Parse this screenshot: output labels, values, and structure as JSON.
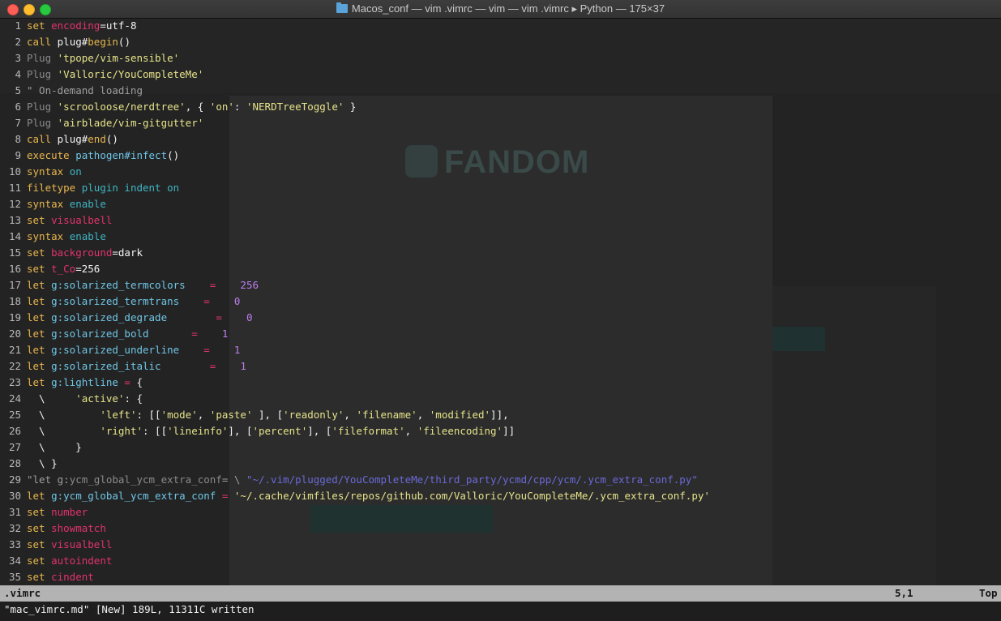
{
  "window": {
    "title": "Macos_conf — vim .vimrc — vim — vim .vimrc ▸ Python — 175×37"
  },
  "background": {
    "logo_text": "FANDOM"
  },
  "editor": {
    "lines": [
      {
        "n": "1",
        "segs": [
          [
            "k",
            "set "
          ],
          [
            "opt",
            "encoding"
          ],
          [
            "w",
            "=utf-8"
          ]
        ]
      },
      {
        "n": "2",
        "segs": [
          [
            "k",
            "call "
          ],
          [
            "w",
            "plug#"
          ],
          [
            "k",
            "begin"
          ],
          [
            "w",
            "()"
          ]
        ]
      },
      {
        "n": "3",
        "segs": [
          [
            "g",
            "Plug "
          ],
          [
            "s",
            "'tpope/vim-sensible'"
          ]
        ]
      },
      {
        "n": "4",
        "segs": [
          [
            "g",
            "Plug "
          ],
          [
            "s",
            "'Valloric/YouCompleteMe'"
          ]
        ]
      },
      {
        "n": "5",
        "segs": [
          [
            "c",
            "\" On-demand loading"
          ]
        ]
      },
      {
        "n": "6",
        "segs": [
          [
            "g",
            "Plug "
          ],
          [
            "s",
            "'scrooloose/nerdtree'"
          ],
          [
            "w",
            ", { "
          ],
          [
            "s",
            "'on'"
          ],
          [
            "w",
            ": "
          ],
          [
            "s",
            "'NERDTreeToggle'"
          ],
          [
            "w",
            " }"
          ]
        ]
      },
      {
        "n": "7",
        "segs": [
          [
            "g",
            "Plug "
          ],
          [
            "s",
            "'airblade/vim-gitgutter'"
          ]
        ]
      },
      {
        "n": "8",
        "segs": [
          [
            "k",
            "call "
          ],
          [
            "w",
            "plug#"
          ],
          [
            "k",
            "end"
          ],
          [
            "w",
            "()"
          ]
        ]
      },
      {
        "n": "9",
        "segs": [
          [
            "k",
            "execute "
          ],
          [
            "f",
            "pathogen#infect"
          ],
          [
            "w",
            "()"
          ]
        ]
      },
      {
        "n": "10",
        "segs": [
          [
            "k",
            "syntax "
          ],
          [
            "cy",
            "on"
          ]
        ]
      },
      {
        "n": "11",
        "segs": [
          [
            "k",
            "filetype "
          ],
          [
            "cy",
            "plugin indent on"
          ]
        ]
      },
      {
        "n": "12",
        "segs": [
          [
            "k",
            "syntax "
          ],
          [
            "cy",
            "enable"
          ]
        ]
      },
      {
        "n": "13",
        "segs": [
          [
            "k",
            "set "
          ],
          [
            "opt",
            "visualbell"
          ]
        ]
      },
      {
        "n": "14",
        "segs": [
          [
            "k",
            "syntax "
          ],
          [
            "cy",
            "enable"
          ]
        ]
      },
      {
        "n": "15",
        "segs": [
          [
            "k",
            "set "
          ],
          [
            "opt",
            "background"
          ],
          [
            "w",
            "=dark"
          ]
        ]
      },
      {
        "n": "16",
        "segs": [
          [
            "k",
            "set "
          ],
          [
            "opt",
            "t_Co"
          ],
          [
            "w",
            "=256"
          ]
        ]
      },
      {
        "n": "17",
        "segs": [
          [
            "k",
            "let "
          ],
          [
            "v",
            "g:solarized_termcolors"
          ],
          [
            "opt",
            "    =    "
          ],
          [
            "n",
            "256"
          ]
        ]
      },
      {
        "n": "18",
        "segs": [
          [
            "k",
            "let "
          ],
          [
            "v",
            "g:solarized_termtrans"
          ],
          [
            "opt",
            "    =    "
          ],
          [
            "n",
            "0"
          ]
        ]
      },
      {
        "n": "19",
        "segs": [
          [
            "k",
            "let "
          ],
          [
            "v",
            "g:solarized_degrade"
          ],
          [
            "opt",
            "        =    "
          ],
          [
            "n",
            "0"
          ]
        ]
      },
      {
        "n": "20",
        "segs": [
          [
            "k",
            "let "
          ],
          [
            "v",
            "g:solarized_bold"
          ],
          [
            "opt",
            "       =    "
          ],
          [
            "n",
            "1"
          ]
        ]
      },
      {
        "n": "21",
        "segs": [
          [
            "k",
            "let "
          ],
          [
            "v",
            "g:solarized_underline"
          ],
          [
            "opt",
            "    =    "
          ],
          [
            "n",
            "1"
          ]
        ]
      },
      {
        "n": "22",
        "segs": [
          [
            "k",
            "let "
          ],
          [
            "v",
            "g:solarized_italic"
          ],
          [
            "opt",
            "        =    "
          ],
          [
            "n",
            "1"
          ]
        ]
      },
      {
        "n": "23",
        "segs": [
          [
            "k",
            "let "
          ],
          [
            "v",
            "g:lightline"
          ],
          [
            "opt",
            " = "
          ],
          [
            "w",
            "{"
          ]
        ]
      },
      {
        "n": "24",
        "segs": [
          [
            "w",
            "  \\     "
          ],
          [
            "s",
            "'active'"
          ],
          [
            "w",
            ": {"
          ]
        ]
      },
      {
        "n": "25",
        "segs": [
          [
            "w",
            "  \\         "
          ],
          [
            "s",
            "'left'"
          ],
          [
            "w",
            ": [["
          ],
          [
            "s",
            "'mode'"
          ],
          [
            "w",
            ", "
          ],
          [
            "s",
            "'paste'"
          ],
          [
            "w",
            " ], ["
          ],
          [
            "s",
            "'readonly'"
          ],
          [
            "w",
            ", "
          ],
          [
            "s",
            "'filename'"
          ],
          [
            "w",
            ", "
          ],
          [
            "s",
            "'modified'"
          ],
          [
            "w",
            "]],"
          ]
        ]
      },
      {
        "n": "26",
        "segs": [
          [
            "w",
            "  \\         "
          ],
          [
            "s",
            "'right'"
          ],
          [
            "w",
            ": [["
          ],
          [
            "s",
            "'lineinfo'"
          ],
          [
            "w",
            "], ["
          ],
          [
            "s",
            "'percent'"
          ],
          [
            "w",
            "], ["
          ],
          [
            "s",
            "'fileformat'"
          ],
          [
            "w",
            ", "
          ],
          [
            "s",
            "'fileencoding'"
          ],
          [
            "w",
            "]]"
          ]
        ]
      },
      {
        "n": "27",
        "segs": [
          [
            "w",
            "  \\     }"
          ]
        ]
      },
      {
        "n": "28",
        "segs": [
          [
            "w",
            "  \\ }"
          ]
        ]
      },
      {
        "n": "29",
        "segs": [
          [
            "c",
            "\"let g:"
          ],
          [
            "g",
            "ycm_global_ycm_extra_conf"
          ],
          [
            "c",
            "= \\ "
          ],
          [
            "cs",
            "\"~/.vim/plugged/YouCompleteMe/third_party/ycmd/cpp/ycm/.ycm_extra_conf.py\""
          ]
        ]
      },
      {
        "n": "30",
        "segs": [
          [
            "k",
            "let "
          ],
          [
            "v",
            "g:ycm_global_ycm_extra_conf"
          ],
          [
            "opt",
            " = "
          ],
          [
            "s",
            "'~/.cache/vimfiles/repos/github.com/Valloric/YouCompleteMe/.ycm_extra_conf.py'"
          ]
        ]
      },
      {
        "n": "31",
        "segs": [
          [
            "k",
            "set "
          ],
          [
            "opt",
            "number"
          ]
        ]
      },
      {
        "n": "32",
        "segs": [
          [
            "k",
            "set "
          ],
          [
            "opt",
            "showmatch"
          ]
        ]
      },
      {
        "n": "33",
        "segs": [
          [
            "k",
            "set "
          ],
          [
            "opt",
            "visualbell"
          ]
        ]
      },
      {
        "n": "34",
        "segs": [
          [
            "k",
            "set "
          ],
          [
            "opt",
            "autoindent"
          ]
        ]
      },
      {
        "n": "35",
        "segs": [
          [
            "k",
            "set "
          ],
          [
            "opt",
            "cindent"
          ]
        ]
      }
    ]
  },
  "statusline": {
    "filename": ".vimrc",
    "position": "5,1",
    "scroll": "Top"
  },
  "cmdline": {
    "message": "\"mac_vimrc.md\" [New] 189L, 11311C written"
  }
}
